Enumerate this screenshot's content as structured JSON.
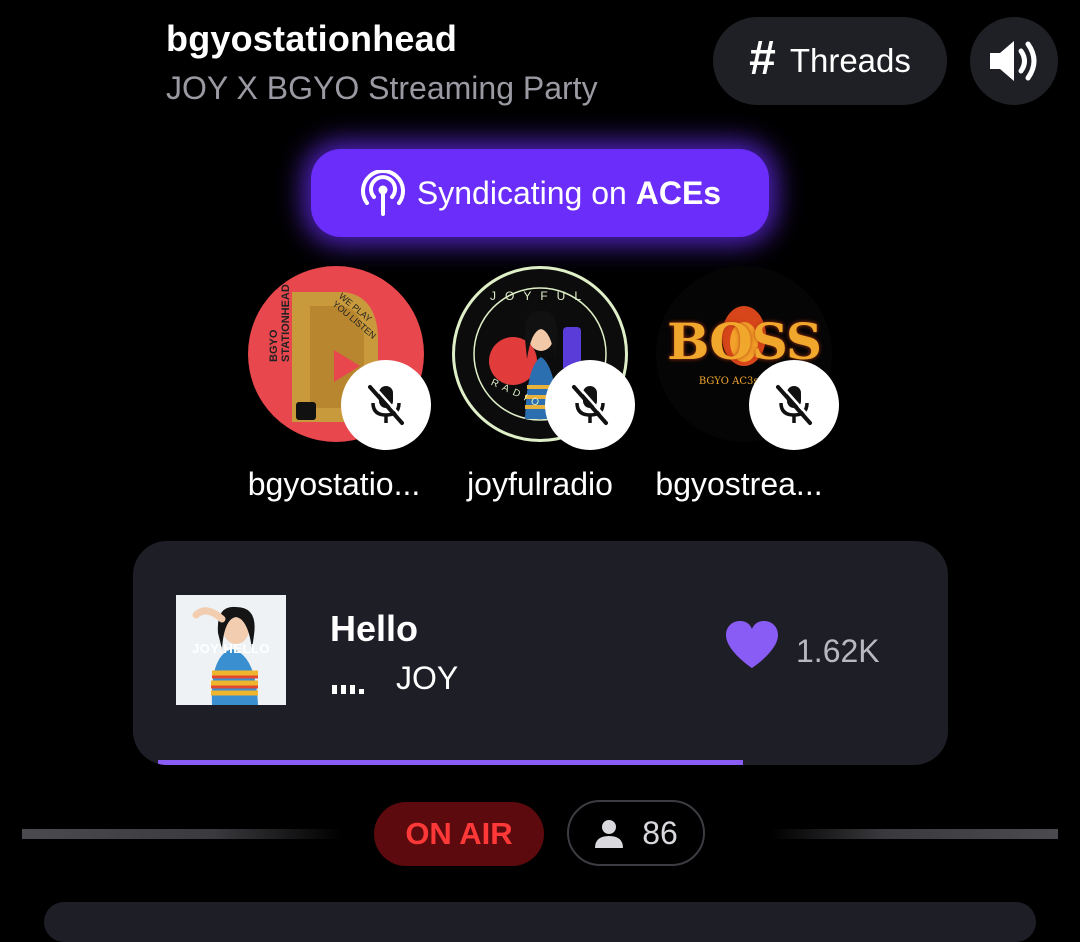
{
  "header": {
    "station_name": "bgyostationhead",
    "subtitle": "JOY X BGYO Streaming Party",
    "threads_label": "Threads",
    "threads_icon": "hash-icon",
    "volume_icon": "speaker-icon"
  },
  "syndicate": {
    "prefix": "Syndicating on ",
    "target": "ACEs",
    "icon": "broadcast-icon",
    "color": "#6a2dfa"
  },
  "hosts": [
    {
      "label": "bgyostatio...",
      "status_icon": "mic-muted-icon",
      "avatar_text": "BGYO STATIONHEAD",
      "avatar_subtext": "WE PLAY YOU LISTEN"
    },
    {
      "label": "joyfulradio",
      "status_icon": "mic-muted-icon",
      "avatar_text": "JOYFUL",
      "avatar_subtext": "RADIO ST"
    },
    {
      "label": "bgyostrea...",
      "status_icon": "mic-muted-icon",
      "avatar_text": "BOSS",
      "avatar_subtext": "BGYO AC3s STR3"
    }
  ],
  "now_playing": {
    "title": "Hello",
    "artist": "JOY",
    "album_art_text": "JOY:HELLO",
    "likes": "1.62K",
    "progress": 0.77,
    "accent": "#8a5cf6"
  },
  "status": {
    "on_air": "ON AIR",
    "listeners": "86",
    "on_air_color": "#ff3838"
  }
}
